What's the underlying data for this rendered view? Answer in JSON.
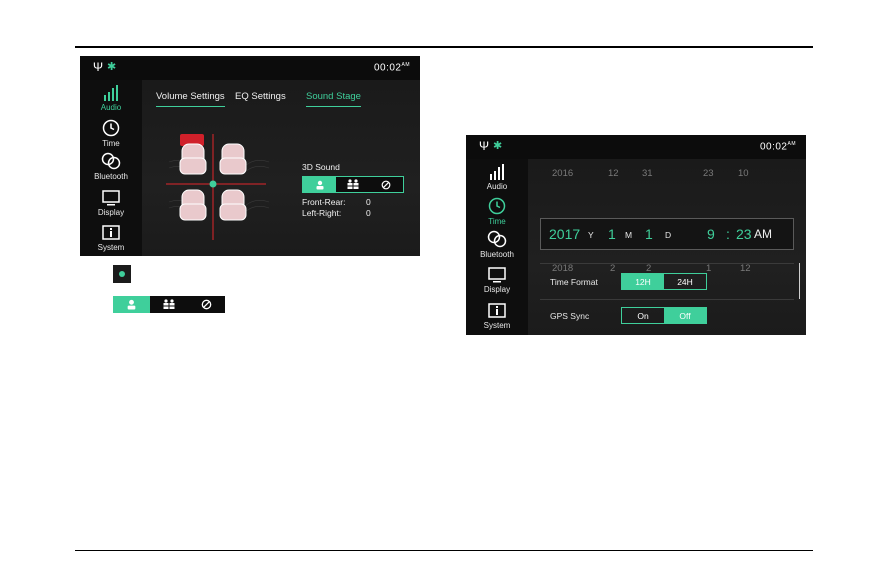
{
  "screen1": {
    "status": {
      "time": "00:02",
      "ampm": "AM",
      "usb_icon": "usb-icon",
      "bt_icon": "bluetooth-icon"
    },
    "sidebar": [
      {
        "label": "Audio",
        "icon": "equalizer-icon",
        "active": true
      },
      {
        "label": "Time",
        "icon": "clock-icon",
        "active": false
      },
      {
        "label": "Bluetooth",
        "icon": "link-icon",
        "active": false
      },
      {
        "label": "Display",
        "icon": "monitor-icon",
        "active": false
      },
      {
        "label": "System",
        "icon": "info-icon",
        "active": false
      }
    ],
    "tabs": [
      {
        "label": "Volume Settings",
        "active": false
      },
      {
        "label": "EQ Settings",
        "active": false
      },
      {
        "label": "Sound Stage",
        "active": true
      }
    ],
    "sound_title": "3D Sound",
    "modes": [
      "person-icon",
      "group-icon",
      "off-icon"
    ],
    "front_rear_label": "Front-Rear:",
    "front_rear_value": "0",
    "left_right_label": "Left-Right:",
    "left_right_value": "0"
  },
  "legend": {
    "dot_icon": "sound-position-dot-icon",
    "modes": [
      "person-icon",
      "group-icon",
      "off-icon"
    ]
  },
  "screen2": {
    "status": {
      "time": "00:02",
      "ampm": "AM"
    },
    "sidebar": [
      {
        "label": "Audio",
        "icon": "equalizer-icon",
        "active": false
      },
      {
        "label": "Time",
        "icon": "clock-icon",
        "active": true
      },
      {
        "label": "Bluetooth",
        "icon": "link-icon",
        "active": false
      },
      {
        "label": "Display",
        "icon": "monitor-icon",
        "active": false
      },
      {
        "label": "System",
        "icon": "info-icon",
        "active": false
      }
    ],
    "prev_row": {
      "year": "2016",
      "month": "12",
      "day": "31",
      "hour": "23",
      "minute": "10"
    },
    "current": {
      "year": "2017",
      "y": "Y",
      "month": "1",
      "m": "M",
      "day": "1",
      "d": "D",
      "hour": "9",
      "sep": ":",
      "minute": "23",
      "ampm": "AM"
    },
    "next_row": {
      "year": "2018",
      "month": "2",
      "day": "2",
      "hour": "1",
      "minute": "12"
    },
    "time_format_label": "Time Format",
    "time_format_options": [
      "12H",
      "24H"
    ],
    "gps_label": "GPS Sync",
    "gps_options": [
      "On",
      "Off"
    ]
  },
  "colors": {
    "accent": "#3fcf9b",
    "screen_bg": "#131313",
    "crosshair": "#e0262b"
  }
}
